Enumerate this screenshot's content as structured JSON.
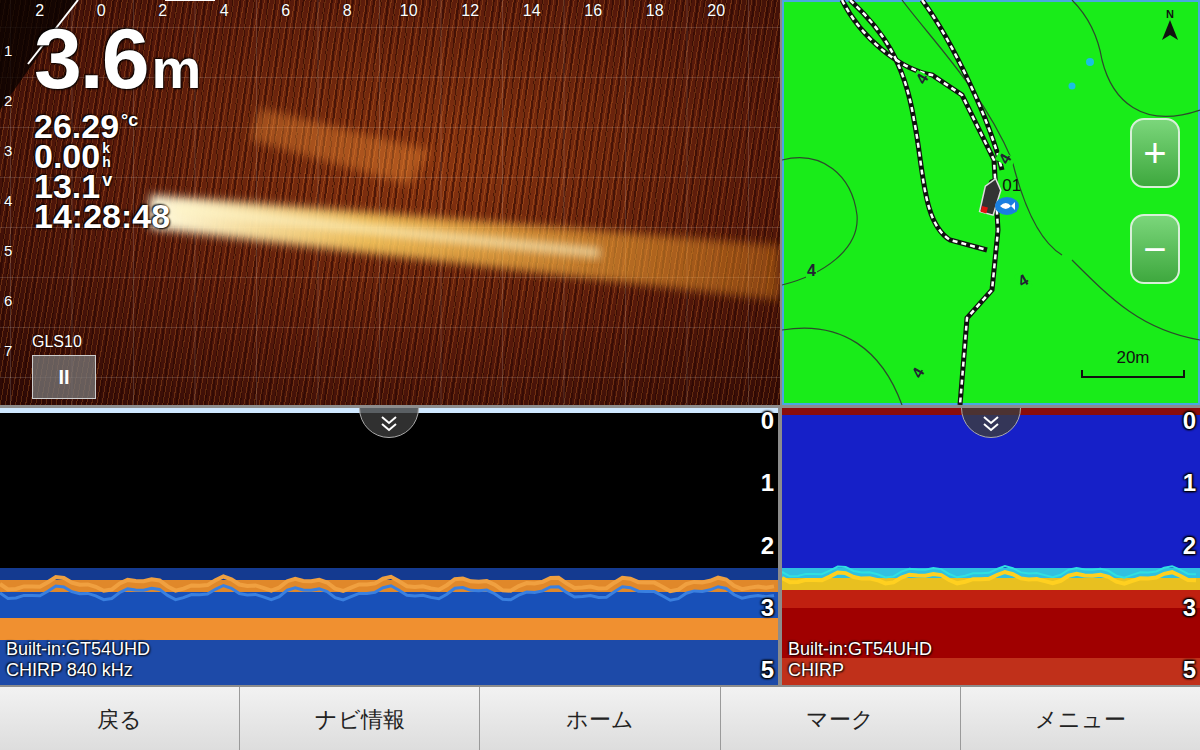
{
  "sonar_live": {
    "source": "GLS10",
    "pause_button": "II",
    "depth_value": "3.6",
    "depth_unit": "m",
    "water_temp": "26.29",
    "temp_unit": "°c",
    "speed": "0.00",
    "speed_unit_top": "k",
    "speed_unit_bottom": "h",
    "voltage": "13.1",
    "voltage_unit": "v",
    "time": "14:28:48",
    "range_scale": [
      "2",
      "0",
      "2",
      "4",
      "6",
      "8",
      "10",
      "12",
      "14",
      "16",
      "18",
      "20"
    ],
    "depth_scale": [
      "1",
      "2",
      "3",
      "4",
      "5",
      "6",
      "7"
    ]
  },
  "map": {
    "north": "N",
    "zoom_in": "+",
    "zoom_out": "−",
    "scale": "20m",
    "boat_label": "0.01",
    "depth_labels": [
      "4",
      "4",
      "4",
      "4",
      "4"
    ]
  },
  "sonar_panels": [
    {
      "kind": "dark",
      "source": "Built-in:GT54UHD",
      "mode": "CHIRP 840 kHz",
      "depth_scale": [
        "0",
        "1",
        "2",
        "3",
        "5"
      ]
    },
    {
      "kind": "blue",
      "source": "Built-in:GT54UHD",
      "mode": "CHIRP",
      "depth_scale": [
        "0",
        "1",
        "2",
        "3",
        "5"
      ]
    }
  ],
  "bottom_bar": {
    "buttons": [
      "戻る",
      "ナビ情報",
      "ホーム",
      "マーク",
      "メニュー"
    ]
  }
}
